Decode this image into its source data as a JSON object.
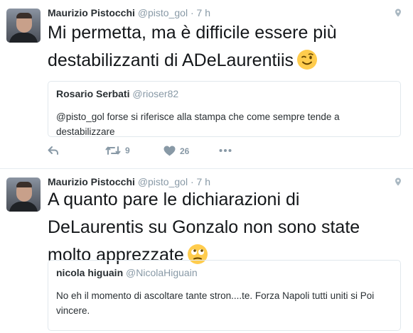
{
  "tweets": [
    {
      "author_name": "Maurizio Pistocchi",
      "author_handle": "@pisto_gol",
      "separator": "·",
      "time": "7 h",
      "text": "Mi permetta, ma è difficile essere più destabilizzanti  di ADeLaurentiis",
      "emoji": "winking-face",
      "quote": {
        "name": "Rosario Serbati",
        "handle": "@rioser82",
        "text": "@pisto_gol forse si riferisce alla stampa che come sempre tende a destabilizzare"
      },
      "actions": {
        "reply_count": "",
        "retweet_count": "9",
        "like_count": "26"
      }
    },
    {
      "author_name": "Maurizio Pistocchi",
      "author_handle": "@pisto_gol",
      "separator": "·",
      "time": "7 h",
      "text": "A quanto pare le dichiarazioni di DeLaurentis su Gonzalo non sono state molto apprezzate",
      "emoji": "face-with-rolling-eyes",
      "quote": {
        "name": "nicola higuain",
        "handle": "@NicolaHiguain",
        "text": "No eh il momento di ascoltare tante stron....te. Forza Napoli tutti uniti si Poi vincere."
      }
    }
  ],
  "colors": {
    "text": "#14171a",
    "secondary": "#8899a6",
    "border": "#e1e8ed",
    "emoji": "#ffcc4d"
  }
}
